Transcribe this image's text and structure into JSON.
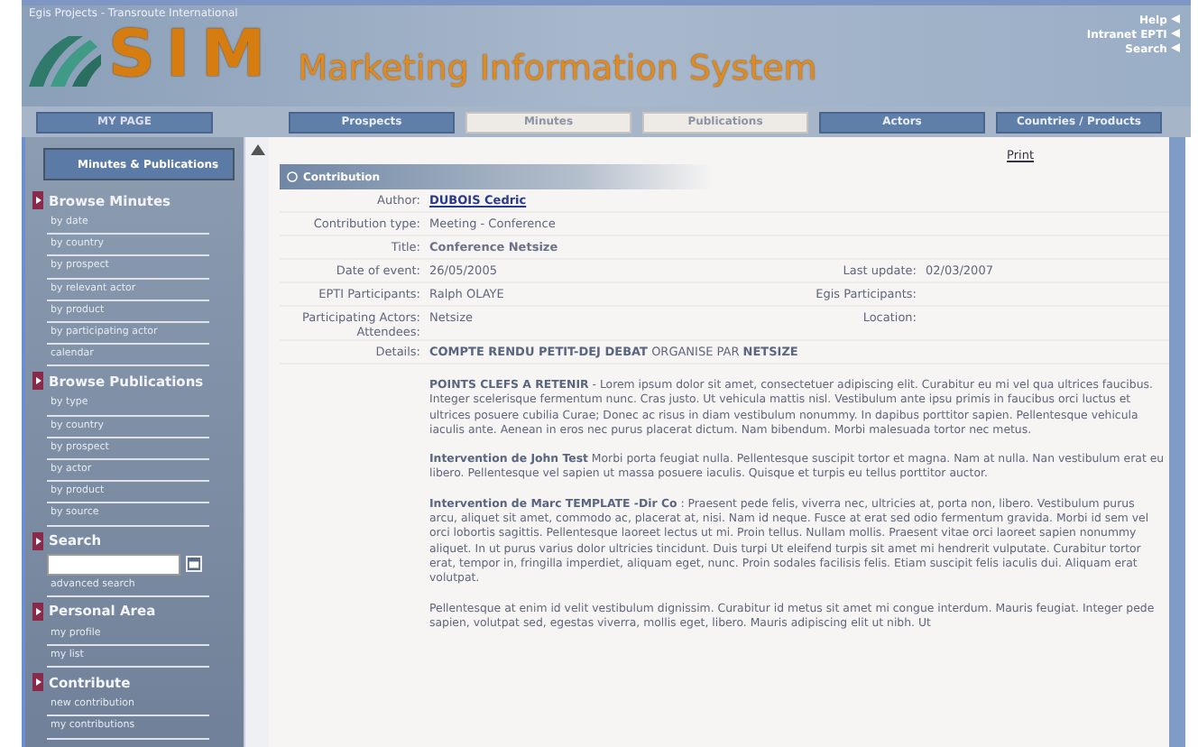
{
  "header": {
    "org": "Egis Projects - Transroute International",
    "logo": "SIM",
    "system_title": "Marketing Information System",
    "top_links": [
      "Help",
      "Intranet EPTI",
      "Search"
    ]
  },
  "nav": {
    "my_page": "MY PAGE",
    "tabs": [
      {
        "label": "Prospects",
        "selected": false
      },
      {
        "label": "Minutes",
        "selected": true
      },
      {
        "label": "Publications",
        "selected": true
      },
      {
        "label": "Actors",
        "selected": false
      },
      {
        "label": "Countries / Products",
        "selected": false
      }
    ]
  },
  "sidebar": {
    "module": "Minutes & Publications",
    "sections": [
      {
        "title": "Browse Minutes",
        "links": [
          "by date",
          "by country",
          "by prospect",
          "by relevant actor",
          "by product",
          "by participating actor",
          "calendar"
        ]
      },
      {
        "title": "Browse Publications",
        "links": [
          "by type",
          "by country",
          "by prospect",
          "by actor",
          "by product",
          "by source"
        ]
      },
      {
        "title": "Search",
        "kind": "search",
        "links": [
          "advanced search"
        ]
      },
      {
        "title": "Personal Area",
        "links": [
          "my profile",
          "my list"
        ]
      },
      {
        "title": "Contribute",
        "links": [
          "new contribution",
          "my contributions"
        ]
      }
    ]
  },
  "content": {
    "panel_title": "Contribution",
    "print": "Print",
    "rows": [
      {
        "cells": [
          {
            "label": "Author:",
            "value": "DUBOIS Cedric",
            "kind": "link"
          }
        ]
      },
      {
        "cells": [
          {
            "label": "Contribution type:",
            "value": "Meeting - Conference",
            "kind": "text"
          }
        ]
      },
      {
        "cells": [
          {
            "label": "Title:",
            "value": "Conference Netsize",
            "kind": "bold"
          }
        ]
      },
      {
        "cells": [
          {
            "label": "Date of event:",
            "value": "26/05/2005",
            "kind": "text"
          },
          {
            "label": "Last update:",
            "value": "02/03/2007",
            "kind": "text"
          }
        ]
      },
      {
        "cells": [
          {
            "label": "EPTI Participants:",
            "value": "Ralph OLAYE",
            "kind": "text"
          },
          {
            "label": "Egis Participants:"
          }
        ]
      },
      {
        "cells": [
          {
            "label": "Participating Actors: Attendees:",
            "value": "Netsize",
            "kind": "text"
          },
          {
            "label": "Location:"
          }
        ]
      }
    ],
    "details_label": "Details:",
    "details_heading": "**COMPTE RENDU PETIT-DEJ DEBAT**  ORGANISE PAR **NETSIZE**",
    "paragraphs": [
      "**POINTS CLEFS A RETENIR** - Lorem ipsum dolor sit amet, consectetuer adipiscing elit. Curabitur eu mi vel qua ultrices faucibus. Integer scelerisque fermentum nunc. Cras justo. Ut vehicula mattis nisl. Vestibulum ante ipsu primis in faucibus orci luctus et ultrices posuere cubilia Curae; Donec ac risus in diam vestibulum nonummy. In dapibus porttitor sapien. Pellentesque vehicula iaculis ante. Aenean in eros nec purus placerat dictum. Nam bibendum. Morbi malesuada tortor nec metus.",
      "**Intervention de John Test** Morbi porta feugiat nulla. Pellentesque suscipit tortor et magna. Nam at nulla. Nan vestibulum erat eu libero. Pellentesque vel sapien ut massa posuere iaculis. Quisque et turpis eu tellus porttitor auctor.",
      "**Intervention de Marc TEMPLATE -Dir Co** : Praesent pede felis, viverra nec, ultricies at, porta non, libero. Vestibulum purus arcu, aliquet sit amet, commodo ac, placerat at, nisi. Nam id neque. Fusce at erat sed odio fermentum gravida. Morbi id sem vel orci lobortis sagittis. Pellentesque laoreet lectus ut mi. Proin tellus. Nullam mollis. Praesent vitae orci laoreet sapien nonummy aliquet. In ut purus varius dolor ultricies tincidunt. Duis turpi Ut eleifend turpis sit amet mi hendrerit vulputate. Curabitur tortor erat, tempor in, fringilla imperdiet, aliquam eget, nunc. Proin sodales facilisis felis. Etiam suscipit felis iaculis dui. Aliquam erat volutpat.",
      "Pellentesque at enim id velit vestibulum dignissim. Curabitur id metus sit amet mi congue interdum. Mauris feugiat. Integer pede sapien, volutpat sed, egestas viverra, mollis eget, libero. Mauris adipiscing elit ut nibh. Ut"
    ]
  }
}
